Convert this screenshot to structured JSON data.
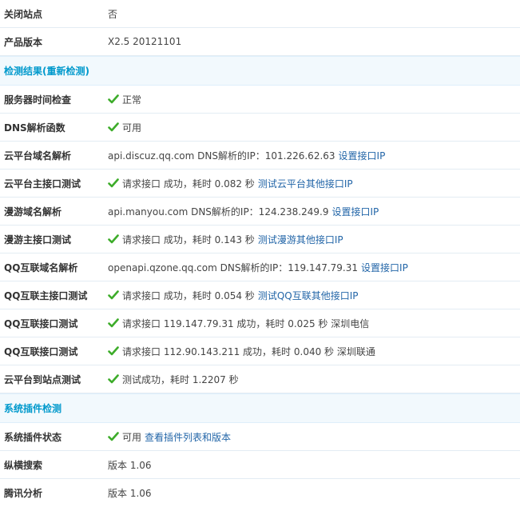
{
  "rows_top": [
    {
      "label": "关闭站点",
      "value": "否"
    },
    {
      "label": "产品版本",
      "value": "X2.5 20121101"
    }
  ],
  "section_check": {
    "title": "检测结果",
    "recheck": "(重新检测)"
  },
  "check_rows": [
    {
      "label": "服务器时间检查",
      "value": "正常"
    },
    {
      "label": "DNS解析函数",
      "value": "可用"
    },
    {
      "label": "云平台域名解析",
      "value": "api.discuz.qq.com DNS解析的IP：101.226.62.63",
      "link": "设置接口IP"
    },
    {
      "label": "云平台主接口测试",
      "value": "请求接口 成功，耗时 0.082 秒",
      "link": "测试云平台其他接口IP"
    },
    {
      "label": "漫游域名解析",
      "value": "api.manyou.com DNS解析的IP：124.238.249.9",
      "link": "设置接口IP"
    },
    {
      "label": "漫游主接口测试",
      "value": "请求接口 成功，耗时 0.143 秒",
      "link": "测试漫游其他接口IP"
    },
    {
      "label": "QQ互联域名解析",
      "value": "openapi.qzone.qq.com DNS解析的IP：119.147.79.31",
      "link": "设置接口IP"
    },
    {
      "label": "QQ互联主接口测试",
      "value": "请求接口 成功，耗时 0.054 秒",
      "link": "测试QQ互联其他接口IP"
    },
    {
      "label": "QQ互联接口测试",
      "value": "请求接口 119.147.79.31 成功，耗时 0.025 秒 深圳电信"
    },
    {
      "label": "QQ互联接口测试",
      "value": "请求接口 112.90.143.211 成功，耗时 0.040 秒 深圳联通"
    },
    {
      "label": "云平台到站点测试",
      "value": "测试成功，耗时 1.2207 秒"
    }
  ],
  "section_plugins": {
    "title": "系统插件检测"
  },
  "plugin_rows": [
    {
      "label": "系统插件状态",
      "value": "可用",
      "link": "查看插件列表和版本"
    },
    {
      "label": "纵横搜索",
      "value": "版本 1.06"
    },
    {
      "label": "腾讯分析",
      "value": "版本 1.06"
    }
  ],
  "colors": {
    "check_green": "#3dac2a",
    "link": "#2366a8",
    "section_text": "#0099cc",
    "section_bg": "#f2f9fd"
  },
  "icons": {
    "check": "check-icon"
  }
}
